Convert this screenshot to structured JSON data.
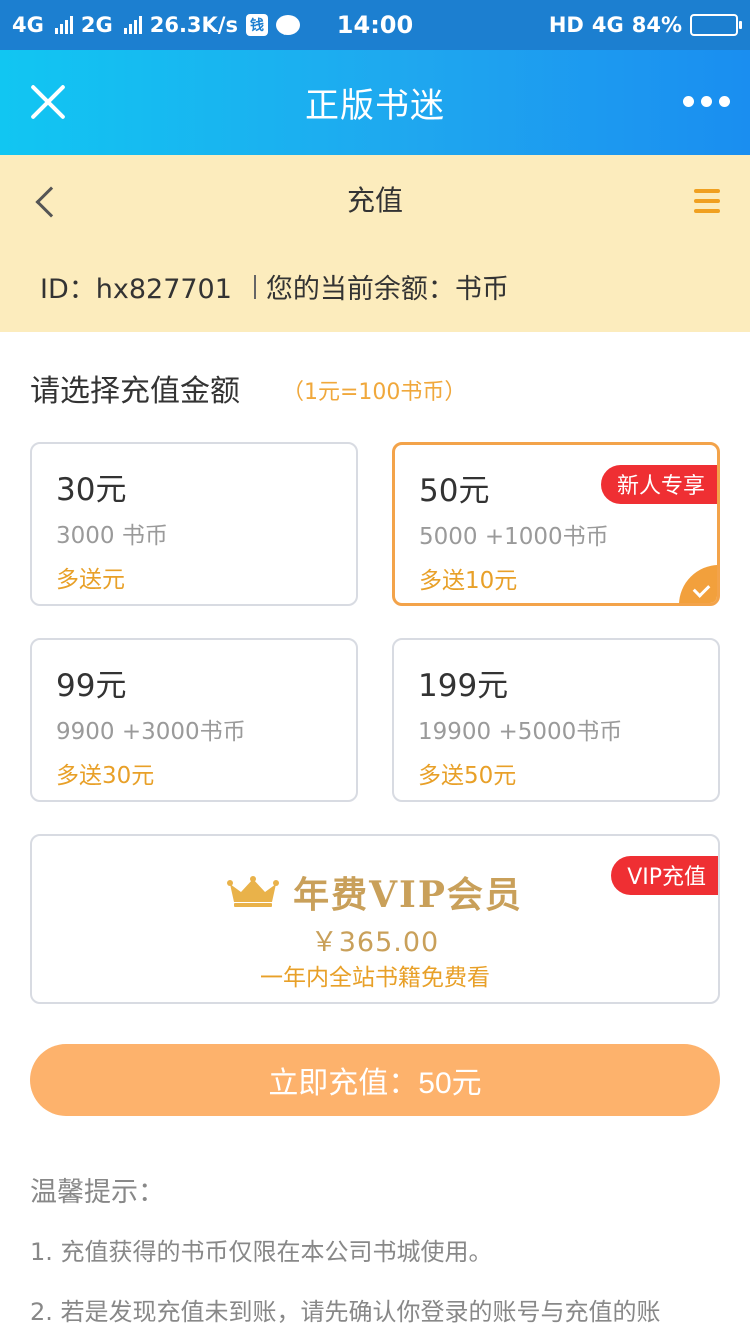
{
  "status_bar": {
    "net1": "4G",
    "net2": "2G",
    "speed": "26.3K/s",
    "app_icon": "钱",
    "time": "14:00",
    "hd": "HD",
    "net3": "4G",
    "battery": "84%",
    "battery_level": 0.84
  },
  "app_bar": {
    "title": "正版书迷"
  },
  "header": {
    "title": "充值",
    "id_text": "ID：hx827701",
    "balance_text": "您的当前余额：书币"
  },
  "section": {
    "title": "请选择充值金额",
    "note": "（1元=100书币）"
  },
  "options": [
    {
      "price": "30元",
      "coins": "3000 书币",
      "bonus": "多送元",
      "tag": "",
      "selected": false
    },
    {
      "price": "50元",
      "coins": "5000 +1000书币",
      "bonus": "多送10元",
      "tag": "新人专享",
      "selected": true
    },
    {
      "price": "99元",
      "coins": "9900 +3000书币",
      "bonus": "多送30元",
      "tag": "",
      "selected": false
    },
    {
      "price": "199元",
      "coins": "19900 +5000书币",
      "bonus": "多送50元",
      "tag": "",
      "selected": false
    }
  ],
  "vip": {
    "tag": "VIP充值",
    "title": "年费VIP会员",
    "price": "￥365.00",
    "desc": "一年内全站书籍免费看"
  },
  "pay_button": {
    "label": "立即充值：50元"
  },
  "tips": {
    "title": "温馨提示：",
    "items": [
      "1. 充值获得的书币仅限在本公司书城使用。",
      "2. 若是发现充值未到账，请先确认你登录的账号与充值的账"
    ]
  },
  "colors": {
    "app_bar": "#1fa7ef",
    "header_bg": "#fcecbd",
    "accent_orange": "#e8a028",
    "tag_red": "#ef2f33",
    "pay_button": "#fdb26c"
  }
}
